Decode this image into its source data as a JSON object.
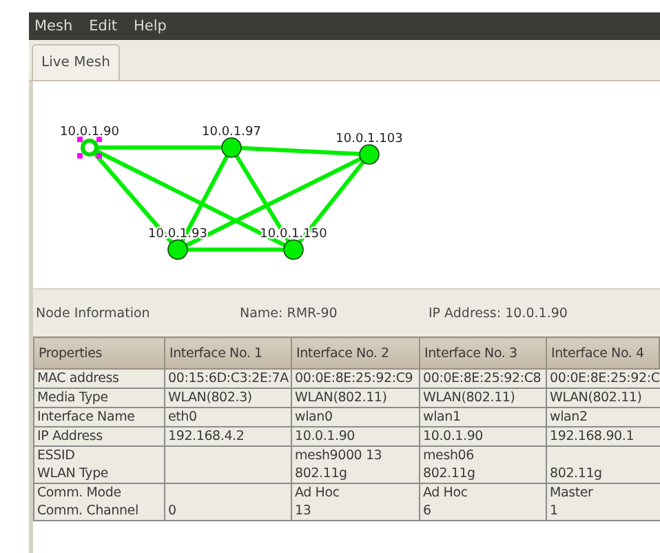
{
  "menu": [
    "Mesh",
    "Edit",
    "Help"
  ],
  "tabs": [
    {
      "label": "Live Mesh",
      "selected": true
    }
  ],
  "graph": {
    "nodes": [
      {
        "label": "10.0.1.90",
        "selected": true
      },
      {
        "label": "10.0.1.97",
        "selected": false
      },
      {
        "label": "10.0.1.103",
        "selected": false
      },
      {
        "label": "10.0.1.93",
        "selected": false
      },
      {
        "label": "10.0.1.150",
        "selected": false
      }
    ]
  },
  "node_info": {
    "heading": "Node Information",
    "name": "Name: RMR-90",
    "ip": "IP Address: 10.0.1.90"
  },
  "table": {
    "columns": [
      "Properties",
      "Interface No. 1",
      "Interface No. 2",
      "Interface No. 3",
      "Interface No. 4"
    ],
    "rows": [
      {
        "lines": [
          {
            "property": "MAC address",
            "interface_1": "00:15:6D:C3:2E:7A",
            "interface_2": "00:0E:8E:25:92:C9",
            "interface_3": "00:0E:8E:25:92:C8",
            "interface_4": "00:0E:8E:25:92:C"
          }
        ]
      },
      {
        "lines": [
          {
            "property": "Media Type",
            "interface_1": "WLAN(802.3)",
            "interface_2": "WLAN(802.11)",
            "interface_3": "WLAN(802.11)",
            "interface_4": "WLAN(802.11)"
          }
        ]
      },
      {
        "lines": [
          {
            "property": "Interface Name",
            "interface_1": "eth0",
            "interface_2": "wlan0",
            "interface_3": "wlan1",
            "interface_4": "wlan2"
          }
        ]
      },
      {
        "lines": [
          {
            "property": "IP Address",
            "interface_1": "192.168.4.2",
            "interface_2": "10.0.1.90",
            "interface_3": "10.0.1.90",
            "interface_4": "192.168.90.1"
          }
        ]
      },
      {
        "lines": [
          {
            "property": "ESSID",
            "interface_2": "mesh9000 13",
            "interface_3": "mesh06"
          },
          {
            "property": "WLAN Type",
            "interface_2": "802.11g",
            "interface_3": "802.11g",
            "interface_4": "802.11g"
          }
        ]
      },
      {
        "lines": [
          {
            "property": "Comm. Mode",
            "interface_2": "Ad Hoc",
            "interface_3": "Ad Hoc",
            "interface_4": "Master"
          },
          {
            "property": "Comm. Channel",
            "interface_1": "0",
            "interface_2": "13",
            "interface_3": "6",
            "interface_4": "1"
          }
        ]
      }
    ]
  }
}
